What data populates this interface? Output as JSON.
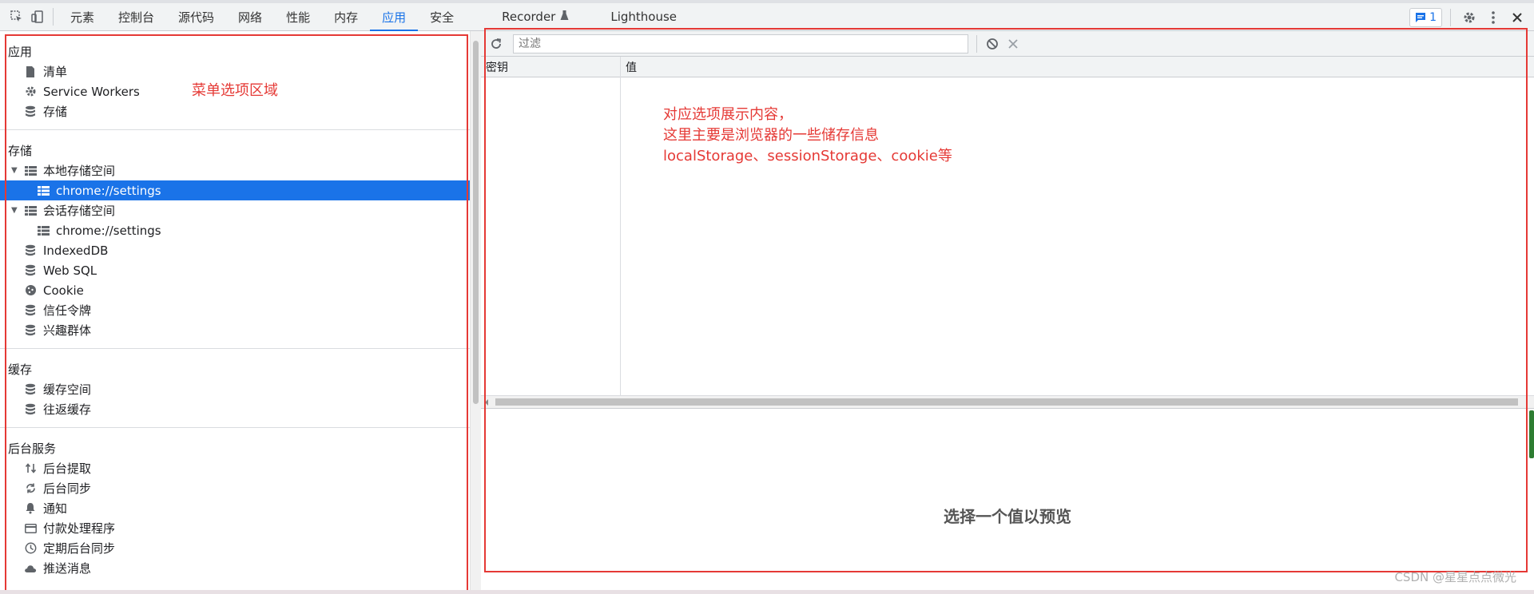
{
  "toolbar": {
    "tabs": [
      "元素",
      "控制台",
      "源代码",
      "网络",
      "性能",
      "内存",
      "应用",
      "安全",
      "Recorder",
      "Lighthouse"
    ],
    "active_tab": "应用",
    "issues_count": "1",
    "accent_color": "#1a73e8"
  },
  "sidebar": {
    "sections": [
      {
        "title": "应用",
        "items": [
          {
            "label": "清单",
            "icon": "file-icon"
          },
          {
            "label": "Service Workers",
            "icon": "gear-icon"
          },
          {
            "label": "存储",
            "icon": "database-icon"
          }
        ]
      },
      {
        "title": "存储",
        "items": [
          {
            "label": "本地存储空间",
            "icon": "table-icon"
          },
          {
            "label": "chrome://settings",
            "icon": "table-icon"
          },
          {
            "label": "会话存储空间",
            "icon": "table-icon"
          },
          {
            "label": "chrome://settings",
            "icon": "table-icon"
          },
          {
            "label": "IndexedDB",
            "icon": "database-icon"
          },
          {
            "label": "Web SQL",
            "icon": "database-icon"
          },
          {
            "label": "Cookie",
            "icon": "cookie-icon"
          },
          {
            "label": "信任令牌",
            "icon": "database-icon"
          },
          {
            "label": "兴趣群体",
            "icon": "database-icon"
          }
        ]
      },
      {
        "title": "缓存",
        "items": [
          {
            "label": "缓存空间",
            "icon": "database-icon"
          },
          {
            "label": "往返缓存",
            "icon": "database-icon"
          }
        ]
      },
      {
        "title": "后台服务",
        "items": [
          {
            "label": "后台提取",
            "icon": "arrows-updown-icon"
          },
          {
            "label": "后台同步",
            "icon": "sync-icon"
          },
          {
            "label": "通知",
            "icon": "bell-icon"
          },
          {
            "label": "付款处理程序",
            "icon": "card-icon"
          },
          {
            "label": "定期后台同步",
            "icon": "clock-icon"
          },
          {
            "label": "推送消息",
            "icon": "cloud-icon"
          }
        ]
      }
    ]
  },
  "main": {
    "filter_placeholder": "过滤",
    "columns": [
      "密钥",
      "值"
    ],
    "preview_text": "选择一个值以预览"
  },
  "annotations": {
    "menu_label": "菜单选项区域",
    "content_line1": "对应选项展示内容，",
    "content_line2": "这里主要是浏览器的一些储存信息",
    "content_line3": "localStorage、sessionStorage、cookie等",
    "color": "#e53935"
  },
  "watermark": "CSDN @星星点点微光"
}
